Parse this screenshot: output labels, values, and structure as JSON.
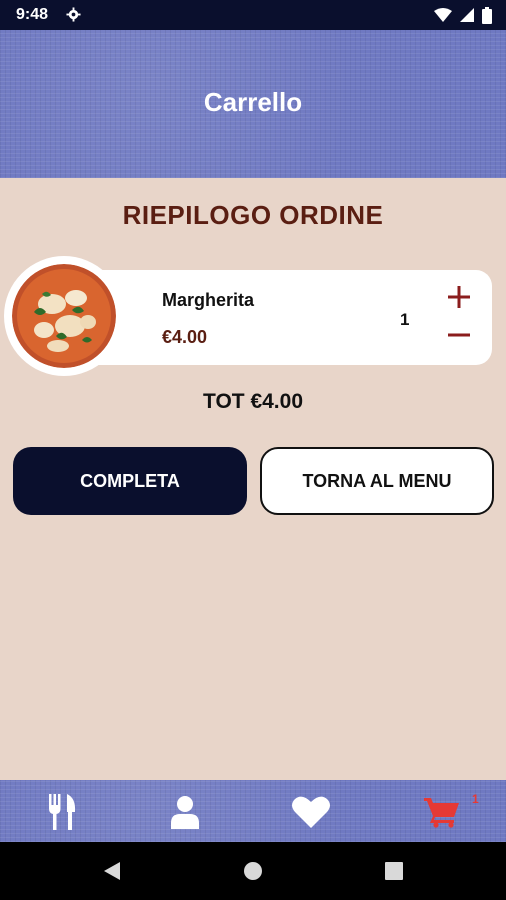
{
  "status_bar": {
    "time": "9:48"
  },
  "header": {
    "title": "Carrello"
  },
  "order": {
    "title": "RIEPILOGO ORDINE",
    "items": [
      {
        "name": "Margherita",
        "price": "€4.00",
        "quantity": "1"
      }
    ],
    "total": "TOT €4.00"
  },
  "actions": {
    "complete_label": "COMPLETA",
    "back_label": "TORNA AL MENU"
  },
  "bottom_nav": {
    "items": [
      "menu-icon",
      "profile-icon",
      "favorites-icon",
      "cart-icon"
    ],
    "cart_badge": "1"
  },
  "colors": {
    "accent": "#0a0f2d",
    "title": "#5a1e12",
    "cart": "#e53935",
    "background": "#e8d5c9"
  }
}
